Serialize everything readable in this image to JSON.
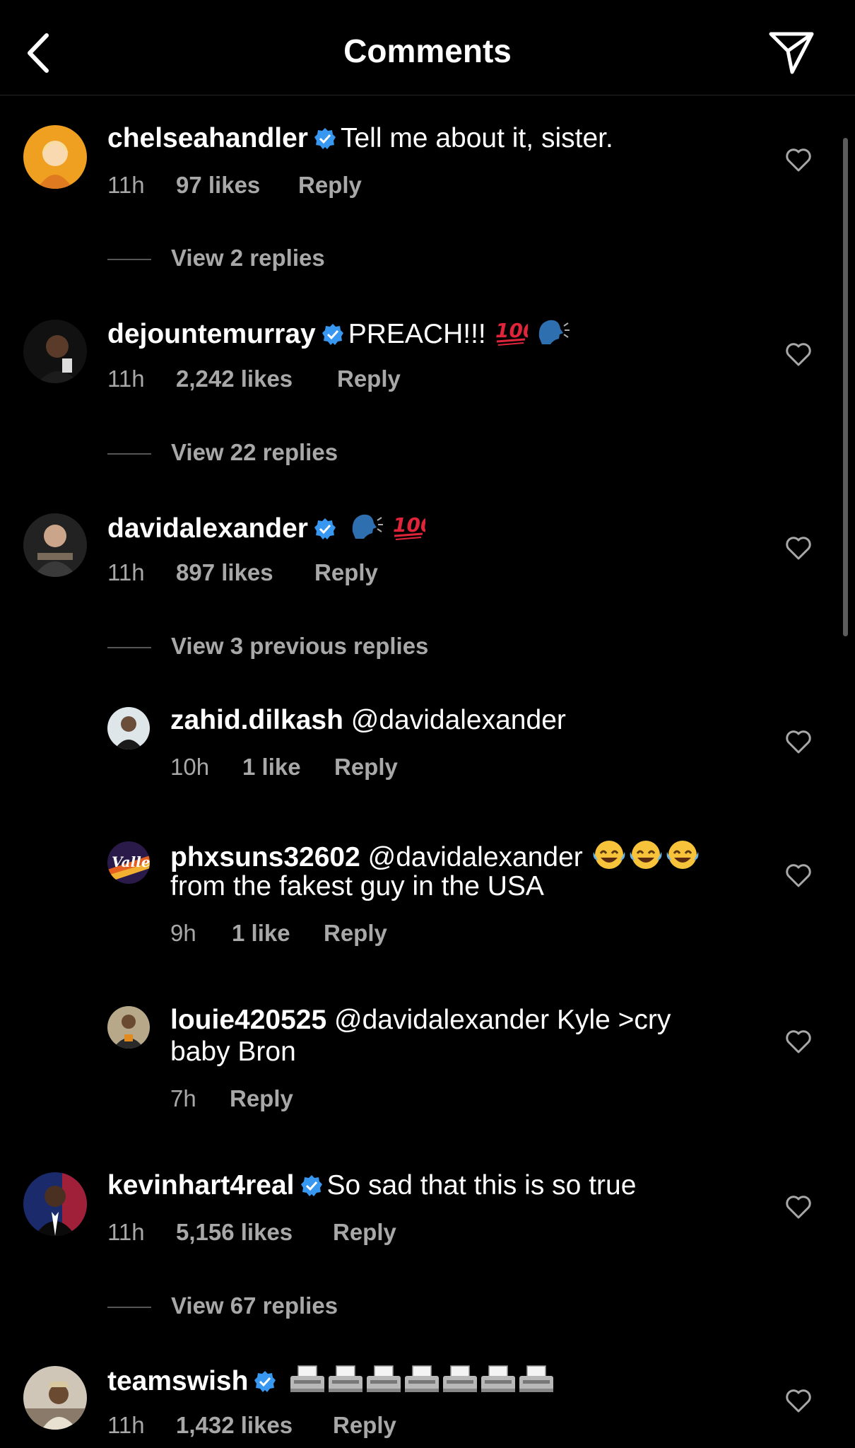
{
  "header": {
    "title": "Comments",
    "back_icon": "chevron-left-icon",
    "share_icon": "paper-plane-icon"
  },
  "comments": [
    {
      "user": "chelseahandler",
      "verified": true,
      "text": "Tell me about it, sister.",
      "time": "11h",
      "likes": "97 likes",
      "reply": "Reply",
      "view_replies": "View 2 replies"
    },
    {
      "user": "dejountemurray",
      "verified": true,
      "text": "PREACH!!!",
      "time": "11h",
      "likes": "2,242 likes",
      "reply": "Reply",
      "view_replies": "View 22 replies"
    },
    {
      "user": "davidalexander",
      "verified": true,
      "text": "",
      "time": "11h",
      "likes": "897 likes",
      "reply": "Reply",
      "view_replies": "View 3 previous replies"
    },
    {
      "user": "kevinhart4real",
      "verified": true,
      "text": "So sad that this is so true",
      "time": "11h",
      "likes": "5,156 likes",
      "reply": "Reply",
      "view_replies": "View 67 replies"
    },
    {
      "user": "teamswish",
      "verified": true,
      "text": "",
      "time": "11h",
      "likes": "1,432 likes",
      "reply": "Reply"
    }
  ],
  "replies": [
    {
      "user": "zahid.dilkash",
      "text": "@davidalexander",
      "time": "10h",
      "likes": "1 like",
      "reply": "Reply"
    },
    {
      "user": "phxsuns32602",
      "text": "@davidalexander",
      "text2": "from the fakest guy in the USA",
      "time": "9h",
      "likes": "1 like",
      "reply": "Reply"
    },
    {
      "user": "louie420525",
      "text": "@davidalexander Kyle >cry",
      "text2": "baby Bron",
      "time": "7h",
      "reply": "Reply"
    }
  ],
  "colors": {
    "background": "#000000",
    "text": "#ffffff",
    "secondary": "#a8a8a8",
    "verified": "#3897f0",
    "hundred": "#e0243a"
  }
}
